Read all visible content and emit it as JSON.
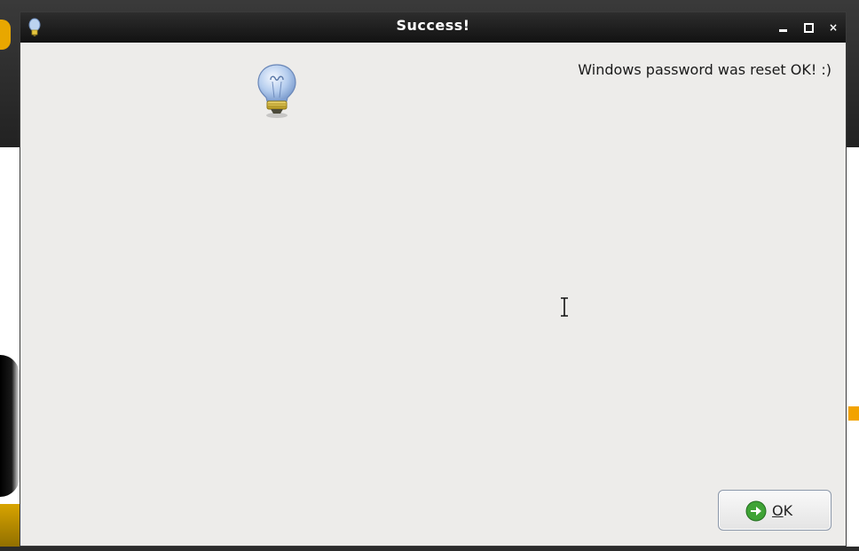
{
  "window": {
    "title": "Success!",
    "icon": "lightbulb-icon",
    "controls": {
      "minimize_icon": "minimize-icon",
      "maximize_icon": "maximize-icon",
      "close_icon": "close-icon",
      "close_glyph": "×"
    }
  },
  "dialog": {
    "message": "Windows password was reset OK! :)",
    "icon": "lightbulb-icon"
  },
  "buttons": {
    "ok": {
      "mnemonic": "O",
      "rest": "K",
      "icon": "arrow-right-circle-icon"
    }
  },
  "colors": {
    "dialog_background": "#edecea",
    "titlebar": "#1a1a1a",
    "ok_icon_green": "#3fa336"
  }
}
